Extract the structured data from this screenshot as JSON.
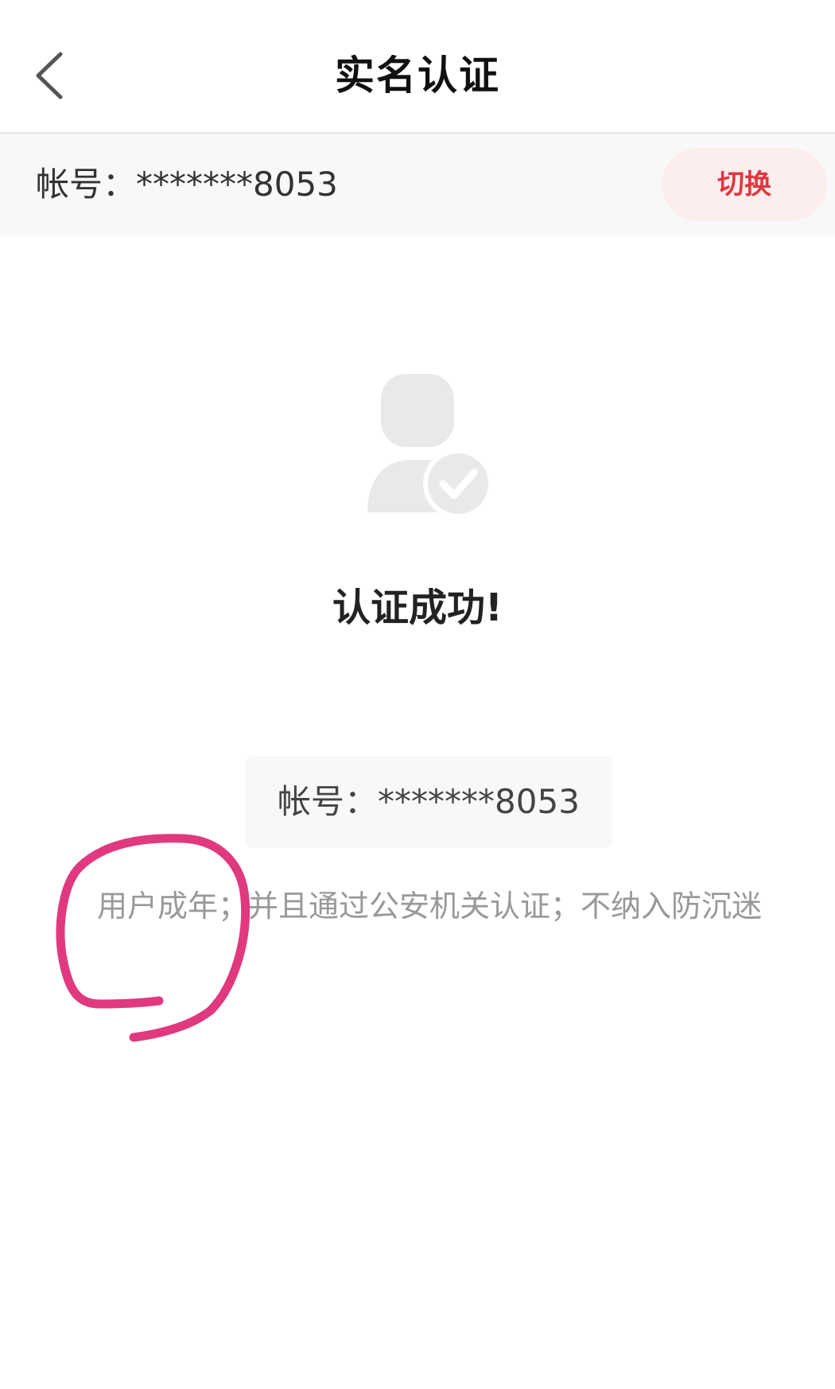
{
  "header": {
    "back_icon": "chevron-left-icon",
    "title": "实名认证"
  },
  "account_strip": {
    "label": "帐号：*******8053",
    "switch_label": "切换",
    "switch_color": "#e0373f",
    "switch_bg": "#fdeeee"
  },
  "result": {
    "icon": "user-verified-icon",
    "title": "认证成功!",
    "account_label": "帐号：*******8053",
    "description": "用户成年；并且通过公安机关认证；不纳入防沉迷"
  },
  "annotation": {
    "type": "hand-drawn-circle",
    "color": "#e0397f"
  }
}
